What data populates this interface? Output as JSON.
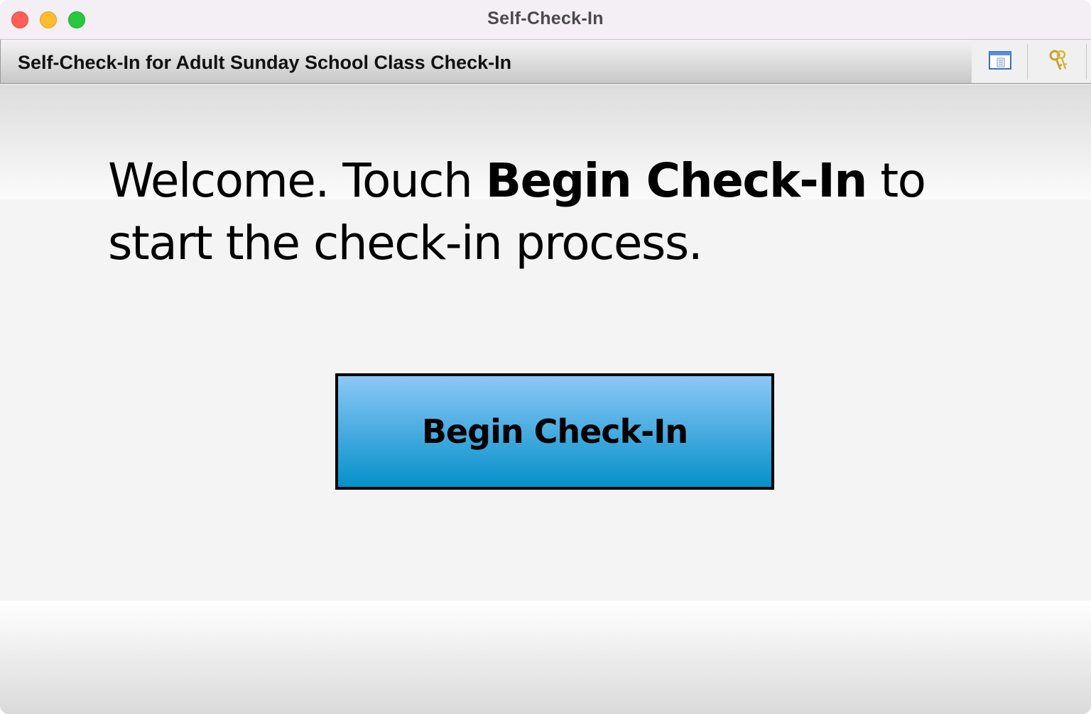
{
  "window": {
    "title": "Self-Check-In"
  },
  "header": {
    "title": "Self-Check-In for Adult Sunday School Class Check-In",
    "tools": [
      {
        "icon": "window-icon"
      },
      {
        "icon": "keys-icon"
      }
    ]
  },
  "main": {
    "welcome_prefix": "Welcome. Touch ",
    "welcome_bold": "Begin Check-In",
    "welcome_suffix": " to start the check-in process.",
    "begin_button_label": "Begin Check-In"
  },
  "colors": {
    "button_top": "#8cc8f7",
    "button_bottom": "#0590c9",
    "close": "#fe5f57",
    "minimize": "#febc2e",
    "maximize": "#28c840"
  }
}
